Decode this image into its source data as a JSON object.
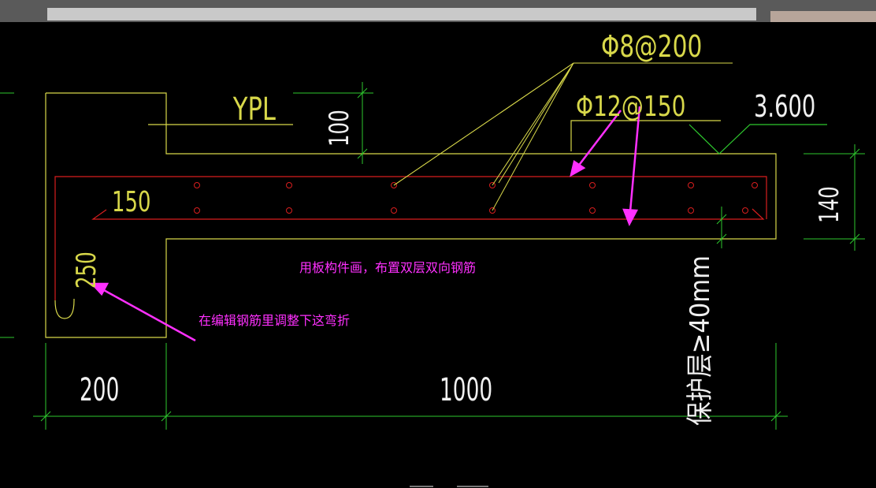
{
  "window": {
    "top_strip_label": "",
    "colors": {
      "background": "#000000",
      "outline": "#d8d84a",
      "rebar": "#d81e1e",
      "dimension": "#2ec82e",
      "leader": "#d8d84a",
      "note": "#ff30ff",
      "white_text": "#f0f0f0"
    }
  },
  "drawing": {
    "label_member": "YPL",
    "callout_top": "Φ8@200",
    "callout_bottom": "Φ12@150",
    "elevation": "3.600",
    "dim_100": "100",
    "dim_140": "140",
    "dim_150": "150",
    "dim_250": "250",
    "dim_200": "200",
    "dim_1000": "1000",
    "cover_note": "保护层≥40mm",
    "note_slab": "用板构件画，布置双层双向钢筋",
    "note_bend": "在编辑钢筋里调整下这弯折",
    "icon_names": [
      "rebar-dot",
      "magenta-arrow",
      "elevation-triangle",
      "dimension-tick"
    ]
  }
}
